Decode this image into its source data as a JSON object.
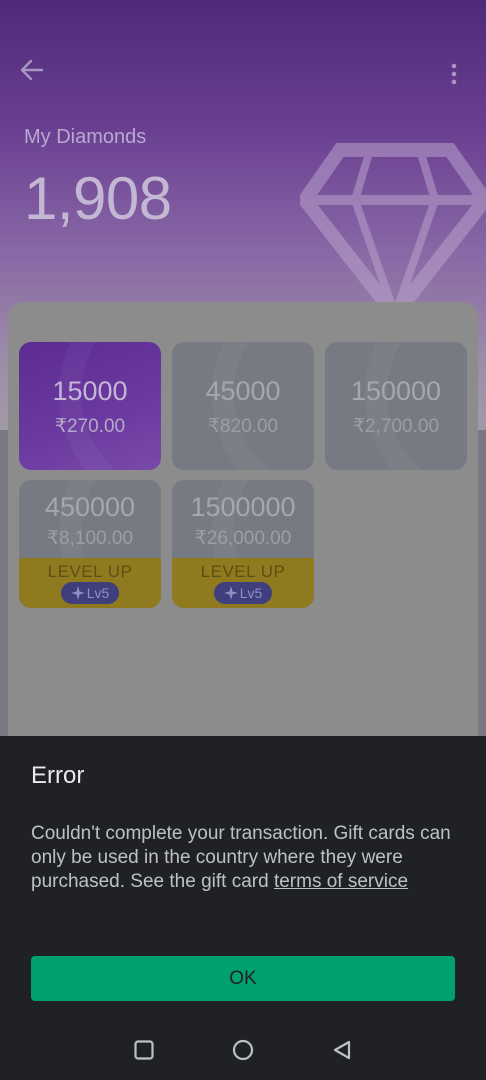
{
  "header": {
    "back_icon": "arrow-left-icon",
    "more_icon": "more-vertical-icon",
    "balance_label": "My Diamonds",
    "balance_value": "1,908"
  },
  "packages": [
    {
      "amount": "15000",
      "price": "₹270.00",
      "selected": true
    },
    {
      "amount": "45000",
      "price": "₹820.00",
      "selected": false
    },
    {
      "amount": "150000",
      "price": "₹2,700.00",
      "selected": false
    },
    {
      "amount": "450000",
      "price": "₹8,100.00",
      "selected": false,
      "level_up": "LEVEL UP",
      "level_badge": "Lv5"
    },
    {
      "amount": "1500000",
      "price": "₹26,000.00",
      "selected": false,
      "level_up": "LEVEL UP",
      "level_badge": "Lv5"
    }
  ],
  "dialog": {
    "title": "Error",
    "message": "Couldn't complete your transaction. Gift cards can only be used in the country where they were purchased. See the gift card ",
    "link_text": "terms of service",
    "ok_label": "OK"
  },
  "navbar": {
    "recents_icon": "square-icon",
    "home_icon": "circle-icon",
    "back_icon": "triangle-back-icon"
  },
  "colors": {
    "accent": "#01a16f",
    "dialog_bg": "#202124",
    "selected_pkg": "#6b3aa0",
    "level_band": "#8f7a1f"
  }
}
